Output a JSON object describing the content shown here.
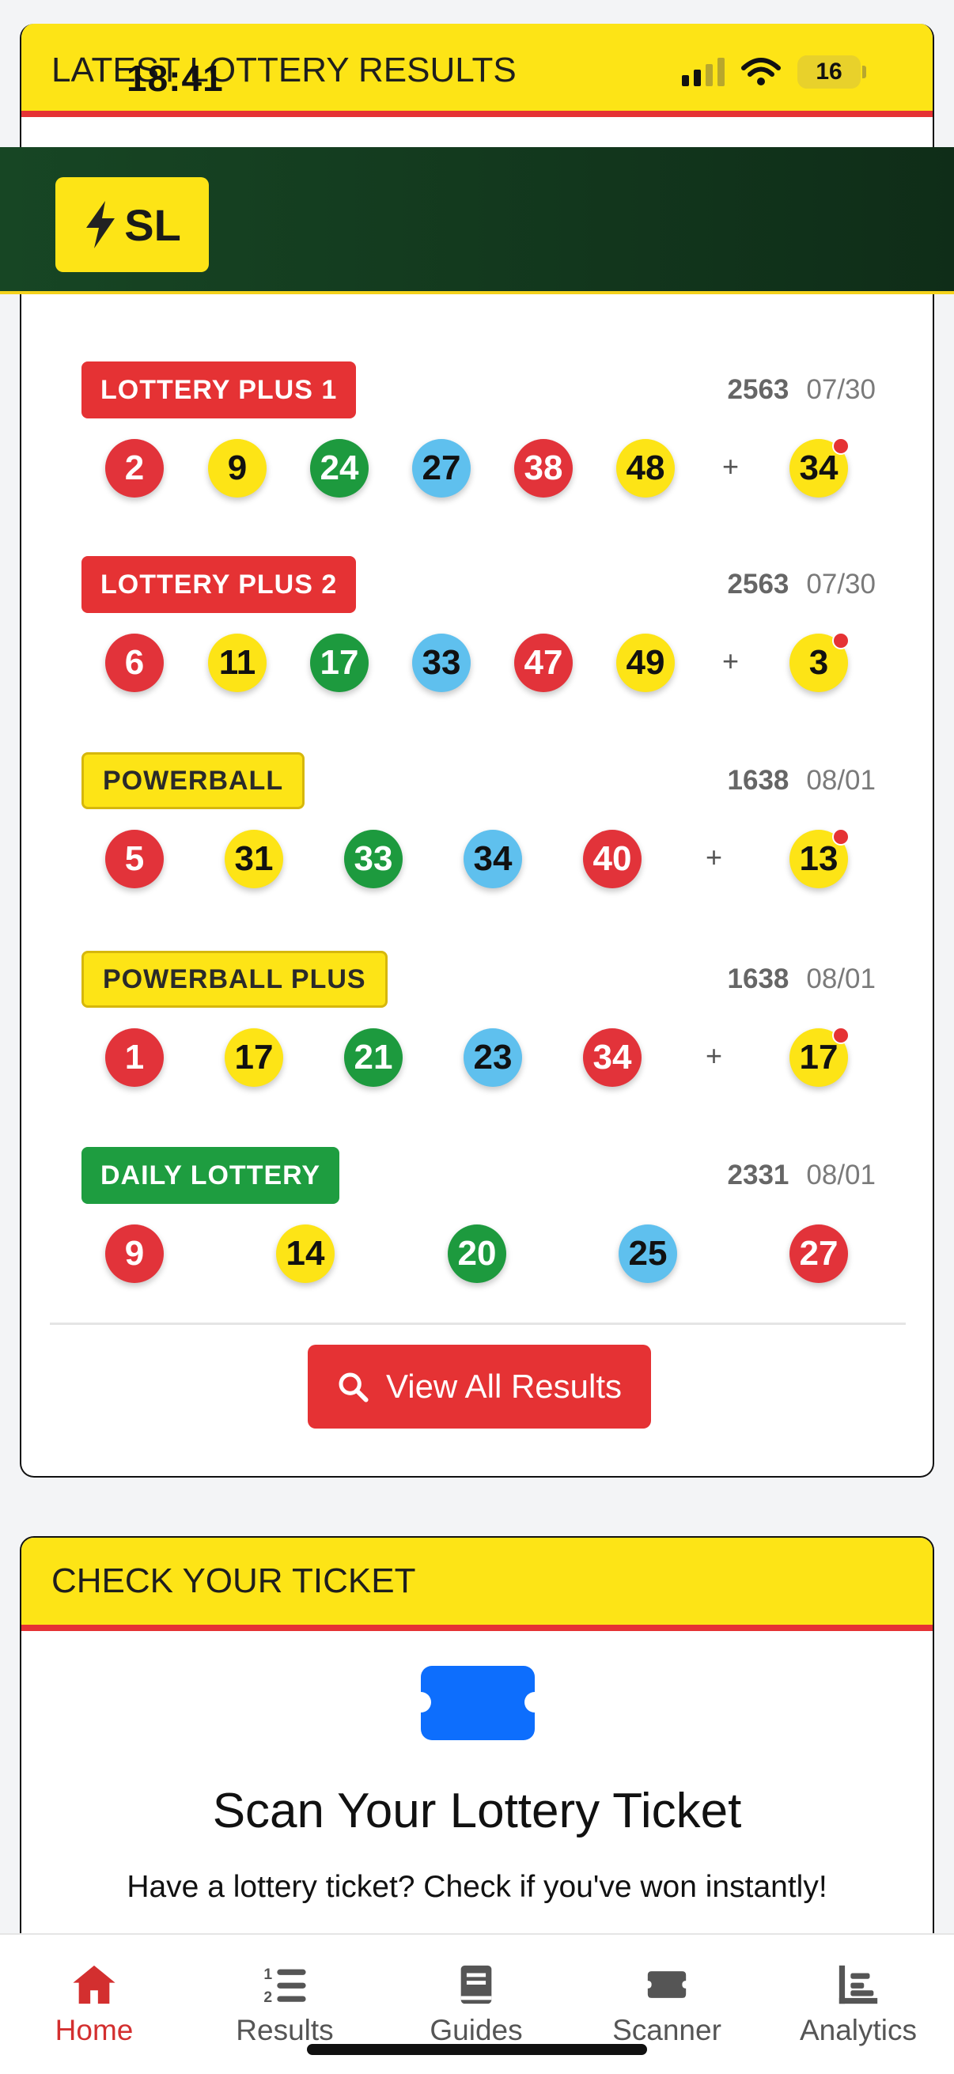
{
  "status_bar": {
    "time": "18:41",
    "battery": "16"
  },
  "app_logo": {
    "text": "SL"
  },
  "results_card": {
    "header": "LATEST LOTTERY RESULTS",
    "view_all_label": "View All Results",
    "games": [
      {
        "name": "LOTTERY PLUS 1",
        "draw": "2563",
        "date": "07/30",
        "balls": [
          "2",
          "9",
          "24",
          "27",
          "38",
          "48"
        ],
        "bonus": "34"
      },
      {
        "name": "LOTTERY PLUS 2",
        "draw": "2563",
        "date": "07/30",
        "balls": [
          "6",
          "11",
          "17",
          "33",
          "47",
          "49"
        ],
        "bonus": "3"
      },
      {
        "name": "POWERBALL",
        "draw": "1638",
        "date": "08/01",
        "balls": [
          "5",
          "31",
          "33",
          "34",
          "40"
        ],
        "bonus": "13"
      },
      {
        "name": "POWERBALL PLUS",
        "draw": "1638",
        "date": "08/01",
        "balls": [
          "1",
          "17",
          "21",
          "23",
          "34"
        ],
        "bonus": "17"
      },
      {
        "name": "DAILY LOTTERY",
        "draw": "2331",
        "date": "08/01",
        "balls": [
          "9",
          "14",
          "20",
          "25",
          "27"
        ]
      }
    ]
  },
  "ticket_card": {
    "header": "CHECK YOUR TICKET",
    "title": "Scan Your Lottery Ticket",
    "subtitle": "Have a lottery ticket? Check if you've won instantly!"
  },
  "bottom_nav": {
    "items": [
      {
        "label": "Home",
        "icon": "home-icon"
      },
      {
        "label": "Results",
        "icon": "list-ordered-icon"
      },
      {
        "label": "Guides",
        "icon": "book-icon"
      },
      {
        "label": "Scanner",
        "icon": "ticket-icon"
      },
      {
        "label": "Analytics",
        "icon": "chart-icon"
      }
    ],
    "active": "Home"
  },
  "colors": {
    "accent_red": "#e53234",
    "accent_yellow": "#fde416",
    "app_green": "#174624",
    "ticket_blue": "#0d6efd"
  }
}
